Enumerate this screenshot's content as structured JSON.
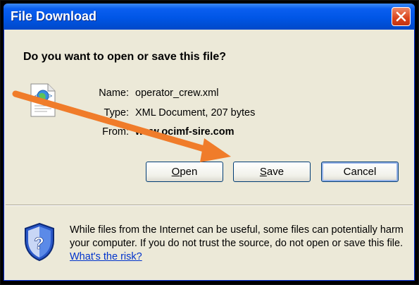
{
  "window": {
    "title": "File Download"
  },
  "dialog": {
    "question": "Do you want to open or save this file?",
    "file": {
      "name_label": "Name:",
      "name_value": "operator_crew.xml",
      "type_label": "Type:",
      "type_value": "XML Document, 207 bytes",
      "from_label": "From:",
      "from_value": "www.ocimf-sire.com",
      "icon": "xml-file-icon"
    },
    "buttons": {
      "open_label": "Open",
      "open_mnemonic": "O",
      "save_label": "Save",
      "save_mnemonic": "S",
      "cancel_label": "Cancel"
    },
    "warning": {
      "text": "While files from the Internet can be useful, some files can potentially harm your computer. If you do not trust the source, do not open or save this file.",
      "link": "What's the risk?",
      "icon": "security-shield-icon"
    }
  },
  "annotation": {
    "arrow_color": "#f07c2a",
    "icon": "annotation-arrow"
  },
  "colors": {
    "titlebar": "#0056e6",
    "dialog_bg": "#ece9d8",
    "close_button": "#d9431c",
    "link": "#0033cc"
  }
}
